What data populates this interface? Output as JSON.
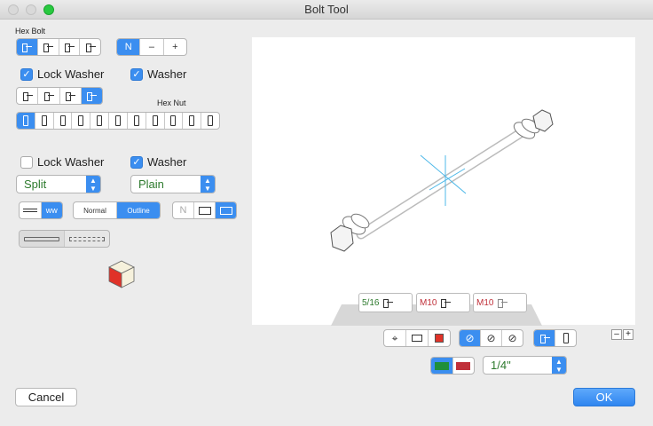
{
  "window": {
    "title": "Bolt Tool"
  },
  "bolt_section": {
    "label": "Hex Bolt"
  },
  "thread_buttons": {
    "normal": "N",
    "minus": "–",
    "plus": "+"
  },
  "top_washers": {
    "lock_washer": "Lock Washer",
    "washer": "Washer",
    "lock_checked": true,
    "washer_checked": true
  },
  "nut_section": {
    "label": "Hex Nut"
  },
  "bottom_washers": {
    "lock_washer": "Lock Washer",
    "washer": "Washer",
    "lock_checked": false,
    "washer_checked": true
  },
  "popups": {
    "lock_type": "Split",
    "washer_type": "Plain"
  },
  "line_style": {
    "normal": "Normal",
    "outline": "Outline"
  },
  "view_buttons": {
    "n": "N"
  },
  "preview_labels": {
    "imperial": "5/16",
    "metric_a": "M10",
    "metric_b": "M10"
  },
  "zoom": {
    "minus": "–",
    "plus": "+"
  },
  "size_popup": {
    "value": "1/4\""
  },
  "colors": {
    "green": "#1f8f3a",
    "red": "#c0303a",
    "accent": "#3b8ef0"
  },
  "buttons": {
    "cancel": "Cancel",
    "ok": "OK"
  }
}
